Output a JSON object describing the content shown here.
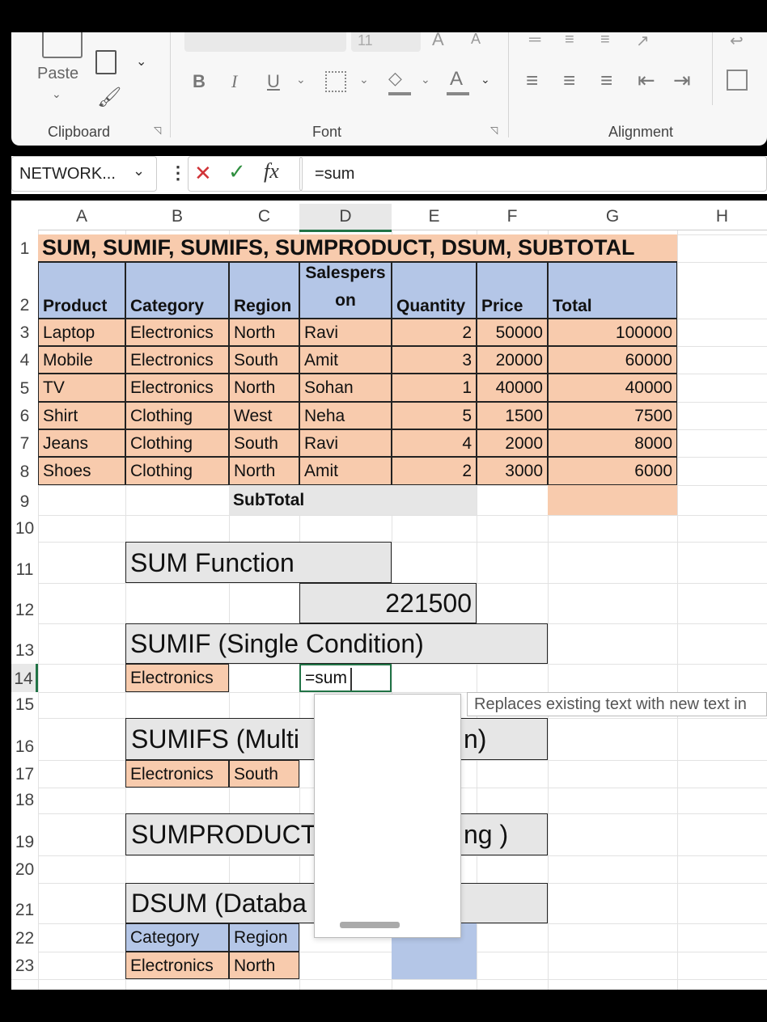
{
  "ribbon": {
    "paste_label": "Paste",
    "groups": {
      "clipboard": "Clipboard",
      "font": "Font",
      "alignment": "Alignment"
    },
    "font_size": "11",
    "font_buttons": {
      "bold": "B",
      "italic": "I",
      "underline": "U",
      "font_color": "A"
    }
  },
  "formula_bar": {
    "name_box": "NETWORK...",
    "cancel": "✕",
    "enter": "✓",
    "fx": "fx",
    "formula": "=sum"
  },
  "columns": [
    "A",
    "B",
    "C",
    "D",
    "E",
    "F",
    "G",
    "H"
  ],
  "rows": [
    "1",
    "2",
    "3",
    "4",
    "5",
    "6",
    "7",
    "8",
    "9",
    "10",
    "11",
    "12",
    "13",
    "14",
    "15",
    "16",
    "17",
    "18",
    "19",
    "20",
    "21",
    "22",
    "23"
  ],
  "title": "SUM, SUMIF, SUMIFS, SUMPRODUCT, DSUM, SUBTOTAL",
  "headers": [
    "Product",
    "Category",
    "Region",
    "Salesperson",
    "Quantity",
    "Price",
    "Total"
  ],
  "headers_salesperson_lines": [
    "Salespers",
    "on"
  ],
  "data_rows": [
    [
      "Laptop",
      "Electronics",
      "North",
      "Ravi",
      "2",
      "50000",
      "100000"
    ],
    [
      "Mobile",
      "Electronics",
      "South",
      "Amit",
      "3",
      "20000",
      "60000"
    ],
    [
      "TV",
      "Electronics",
      "North",
      "Sohan",
      "1",
      "40000",
      "40000"
    ],
    [
      "Shirt",
      "Clothing",
      "West",
      "Neha",
      "5",
      "1500",
      "7500"
    ],
    [
      "Jeans",
      "Clothing",
      "South",
      "Ravi",
      "4",
      "2000",
      "8000"
    ],
    [
      "Shoes",
      "Clothing",
      "North",
      "Amit",
      "2",
      "3000",
      "6000"
    ]
  ],
  "subtotal_label": "SubTotal",
  "sections": {
    "sum_title": "SUM Function",
    "sum_result": "221500",
    "sumif_title": "SUMIF (Single Condition)",
    "sumif_criteria": "Electronics",
    "sumif_edit": "=sum",
    "sumifs_title_left": "SUMIFS (Multi",
    "sumifs_title_right": "n)",
    "sumifs_criteria": [
      "Electronics",
      "South"
    ],
    "sumproduct_title_left": "SUMPRODUCT",
    "sumproduct_title_right": "ng )",
    "dsum_title_left": "DSUM (Databa",
    "dsum_headers": [
      "Category",
      "Region"
    ],
    "dsum_values": [
      "Electronics",
      "North"
    ]
  },
  "tooltip": "Replaces existing text with new text in",
  "colors": {
    "orange": "#f8cbad",
    "blue": "#b4c6e7",
    "gray": "#e6e6e6",
    "accent_green": "#217346"
  }
}
